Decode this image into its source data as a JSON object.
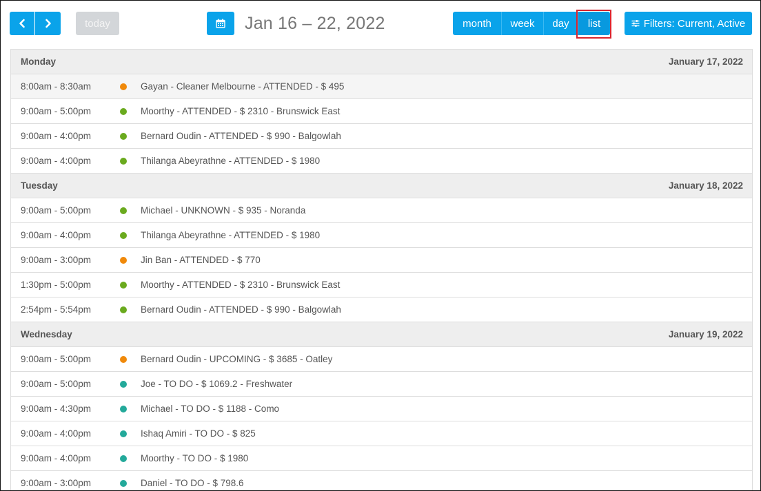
{
  "toolbar": {
    "prev_icon": "chevron-left-icon",
    "next_icon": "chevron-right-icon",
    "today_label": "today",
    "calendar_icon": "calendar-icon",
    "range_title": "Jan 16 – 22, 2022",
    "views": {
      "month": "month",
      "week": "week",
      "day": "day",
      "list": "list"
    },
    "active_view": "list",
    "filter_icon": "sliders-icon",
    "filter_label": "Filters: Current, Active"
  },
  "colors": {
    "primary": "#0aa3ea",
    "highlight": "#d9232e",
    "status_orange": "#f0890a",
    "status_green": "#6aaa1e",
    "status_teal": "#23a99a"
  },
  "days": [
    {
      "name": "Monday",
      "date": "January 17, 2022",
      "events": [
        {
          "time": "8:00am - 8:30am",
          "color": "#f0890a",
          "title": "Gayan - Cleaner Melbourne - ATTENDED - $ 495"
        },
        {
          "time": "9:00am - 5:00pm",
          "color": "#6aaa1e",
          "title": "Moorthy - ATTENDED - $ 2310 - Brunswick East"
        },
        {
          "time": "9:00am - 4:00pm",
          "color": "#6aaa1e",
          "title": "Bernard Oudin - ATTENDED - $ 990 - Balgowlah"
        },
        {
          "time": "9:00am - 4:00pm",
          "color": "#6aaa1e",
          "title": "Thilanga Abeyrathne - ATTENDED - $ 1980"
        }
      ]
    },
    {
      "name": "Tuesday",
      "date": "January 18, 2022",
      "events": [
        {
          "time": "9:00am - 5:00pm",
          "color": "#6aaa1e",
          "title": "Michael - UNKNOWN - $ 935 - Noranda"
        },
        {
          "time": "9:00am - 4:00pm",
          "color": "#6aaa1e",
          "title": "Thilanga Abeyrathne - ATTENDED - $ 1980"
        },
        {
          "time": "9:00am - 3:00pm",
          "color": "#f0890a",
          "title": "Jin Ban - ATTENDED - $ 770"
        },
        {
          "time": "1:30pm - 5:00pm",
          "color": "#6aaa1e",
          "title": "Moorthy - ATTENDED - $ 2310 - Brunswick East"
        },
        {
          "time": "2:54pm - 5:54pm",
          "color": "#6aaa1e",
          "title": "Bernard Oudin - ATTENDED - $ 990 - Balgowlah"
        }
      ]
    },
    {
      "name": "Wednesday",
      "date": "January 19, 2022",
      "events": [
        {
          "time": "9:00am - 5:00pm",
          "color": "#f0890a",
          "title": "Bernard Oudin - UPCOMING - $ 3685 - Oatley"
        },
        {
          "time": "9:00am - 5:00pm",
          "color": "#23a99a",
          "title": "Joe - TO DO - $ 1069.2 - Freshwater"
        },
        {
          "time": "9:00am - 4:30pm",
          "color": "#23a99a",
          "title": "Michael - TO DO - $ 1188 - Como"
        },
        {
          "time": "9:00am - 4:00pm",
          "color": "#23a99a",
          "title": "Ishaq Amiri - TO DO - $ 825"
        },
        {
          "time": "9:00am - 4:00pm",
          "color": "#23a99a",
          "title": "Moorthy - TO DO - $ 1980"
        },
        {
          "time": "9:00am - 3:00pm",
          "color": "#23a99a",
          "title": "Daniel - TO DO - $ 798.6"
        }
      ]
    }
  ]
}
